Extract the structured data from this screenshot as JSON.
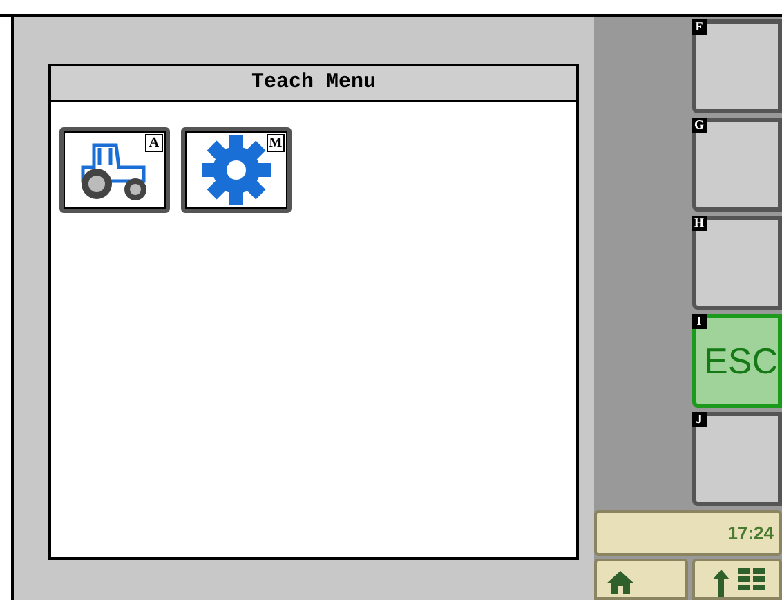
{
  "window": {
    "title": "Teach Menu"
  },
  "tiles": [
    {
      "kind": "tractor",
      "badge": "A"
    },
    {
      "kind": "gear",
      "badge": "M"
    }
  ],
  "softkeys": [
    {
      "letter": "F",
      "highlighted": false
    },
    {
      "letter": "G",
      "highlighted": false
    },
    {
      "letter": "H",
      "highlighted": false
    },
    {
      "letter": "I",
      "label": "ESC",
      "highlighted": true
    },
    {
      "letter": "J",
      "highlighted": false
    }
  ],
  "clock": "17:24"
}
